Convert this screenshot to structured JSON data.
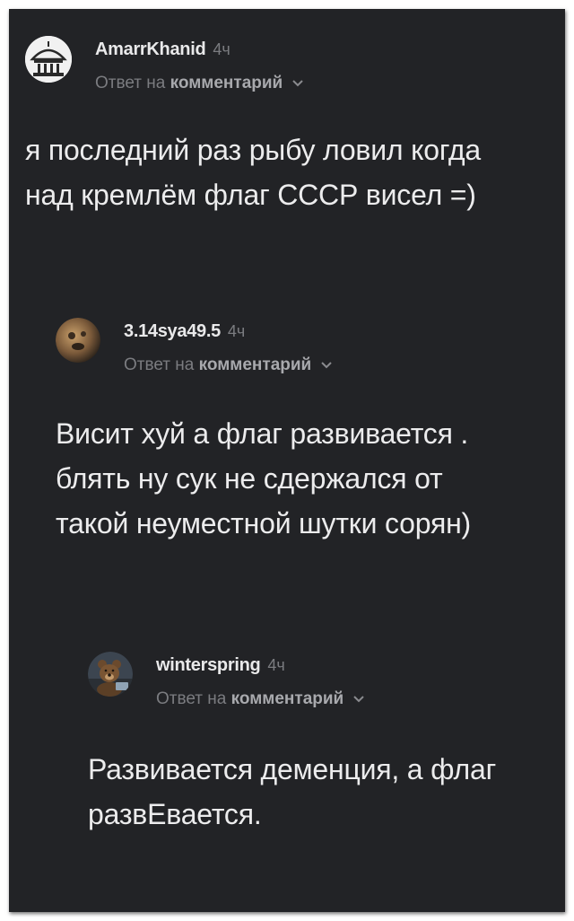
{
  "comments": [
    {
      "author": "AmarrKhanid",
      "time": "4ч",
      "reply_prefix": "Ответ на",
      "reply_link": "комментарий",
      "avatar_icon": "temple-avatar-icon",
      "text_lines": [
        "я последний раз рыбу ловил когда",
        "над кремлём флаг СССР висел =)"
      ]
    },
    {
      "author": "3.14sya49.5",
      "time": "4ч",
      "reply_prefix": "Ответ на",
      "reply_link": "комментарий",
      "avatar_icon": "planet-avatar-icon",
      "text_lines": [
        "Висит хуй а флаг развивается .",
        "блять ну сук не сдержался от",
        "такой неуместной шутки сорян)"
      ]
    },
    {
      "author": "winterspring",
      "time": "4ч",
      "reply_prefix": "Ответ на",
      "reply_link": "комментарий",
      "avatar_icon": "bear-avatar-icon",
      "text_lines": [
        "Развивается деменция, а флаг",
        "развЕвается."
      ]
    }
  ],
  "colors": {
    "background": "#222326",
    "text": "#ececed",
    "muted": "#7b7c80",
    "link": "#a8a9ad"
  }
}
